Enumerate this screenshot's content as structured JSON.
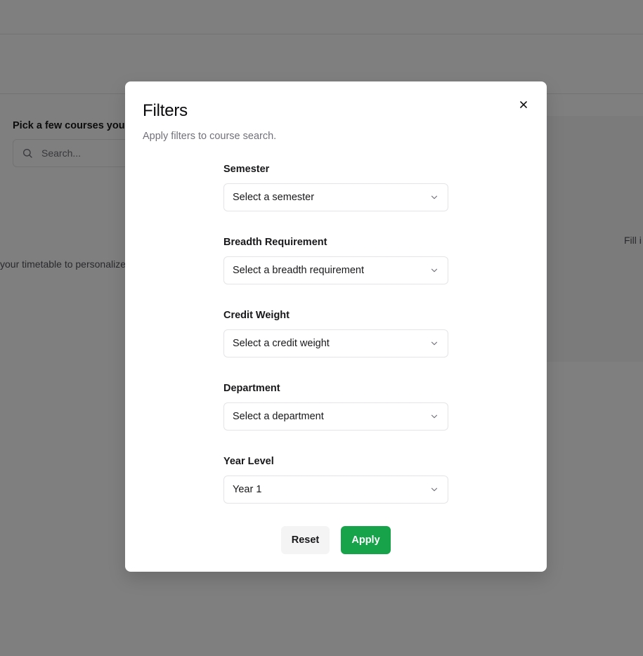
{
  "background": {
    "course_prompt": "Pick a few courses you'd",
    "search_placeholder": "Search...",
    "timetable_text": "your timetable to personalize",
    "fill_text": "Fill i"
  },
  "modal": {
    "title": "Filters",
    "description": "Apply filters to course search.",
    "close_icon": "x-icon",
    "fields": [
      {
        "label": "Semester",
        "value": "Select a semester"
      },
      {
        "label": "Breadth Requirement",
        "value": "Select a breadth requirement"
      },
      {
        "label": "Credit Weight",
        "value": "Select a credit weight"
      },
      {
        "label": "Department",
        "value": "Select a department"
      },
      {
        "label": "Year Level",
        "value": "Year 1"
      }
    ],
    "reset_label": "Reset",
    "apply_label": "Apply"
  },
  "colors": {
    "accent": "#16a34a",
    "overlay": "rgba(0,0,0,0.5)"
  }
}
